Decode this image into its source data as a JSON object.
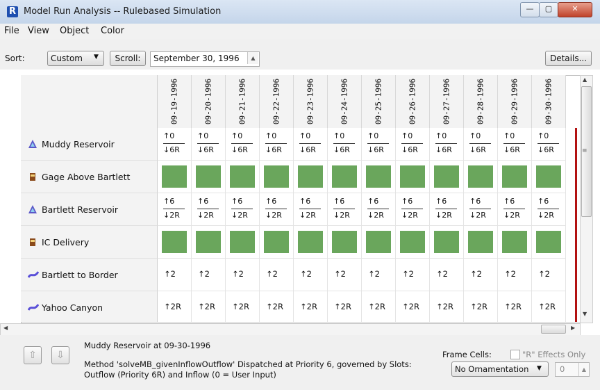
{
  "window": {
    "title": "Model Run Analysis -- Rulebased Simulation",
    "minimize": "—",
    "maximize": "▢",
    "close": "✕"
  },
  "menu": [
    "File",
    "View",
    "Object",
    "Color"
  ],
  "toolbar": {
    "sort_label": "Sort:",
    "sort_value": "Custom",
    "scroll_button": "Scroll:",
    "date_value": "September 30, 1996",
    "details_button": "Details..."
  },
  "dates": [
    "09-19-1996",
    "09-20-1996",
    "09-21-1996",
    "09-22-1996",
    "09-23-1996",
    "09-24-1996",
    "09-25-1996",
    "09-26-1996",
    "09-27-1996",
    "09-28-1996",
    "09-29-1996",
    "09-30-1996"
  ],
  "rows": [
    {
      "label": "Muddy Reservoir",
      "icon": "reservoir-icon",
      "kind": "fraction",
      "top": "↑0",
      "bottom": "↓6R"
    },
    {
      "label": "Gage Above Bartlett",
      "icon": "gage-icon",
      "kind": "block"
    },
    {
      "label": "Bartlett Reservoir",
      "icon": "reservoir-icon",
      "kind": "fraction",
      "top": "↑6",
      "bottom": "↓2R"
    },
    {
      "label": "IC Delivery",
      "icon": "gage-icon",
      "kind": "block"
    },
    {
      "label": "Bartlett to Border",
      "icon": "reach-icon",
      "kind": "single",
      "value": "↑2"
    },
    {
      "label": "Yahoo Canyon",
      "icon": "reach-icon",
      "kind": "single",
      "value": "↑2R"
    }
  ],
  "status": {
    "title": "Muddy Reservoir at 09-30-1996",
    "line1": "Method 'solveMB_givenInflowOutflow' Dispatched at Priority 6, governed by Slots:",
    "line2": "Outflow (Priority 6R) and Inflow (0 = User Input)"
  },
  "frame": {
    "label": "Frame Cells:",
    "checkbox_label": "\"R\" Effects Only",
    "select_value": "No Ornamentation",
    "number_value": "0"
  },
  "colors": {
    "block_fill": "#6aa65c",
    "current_marker": "#b31212",
    "reservoir_icon": "#5b57c8",
    "gage_icon": "#8a4a1a",
    "reach_icon": "#5a50d8"
  }
}
